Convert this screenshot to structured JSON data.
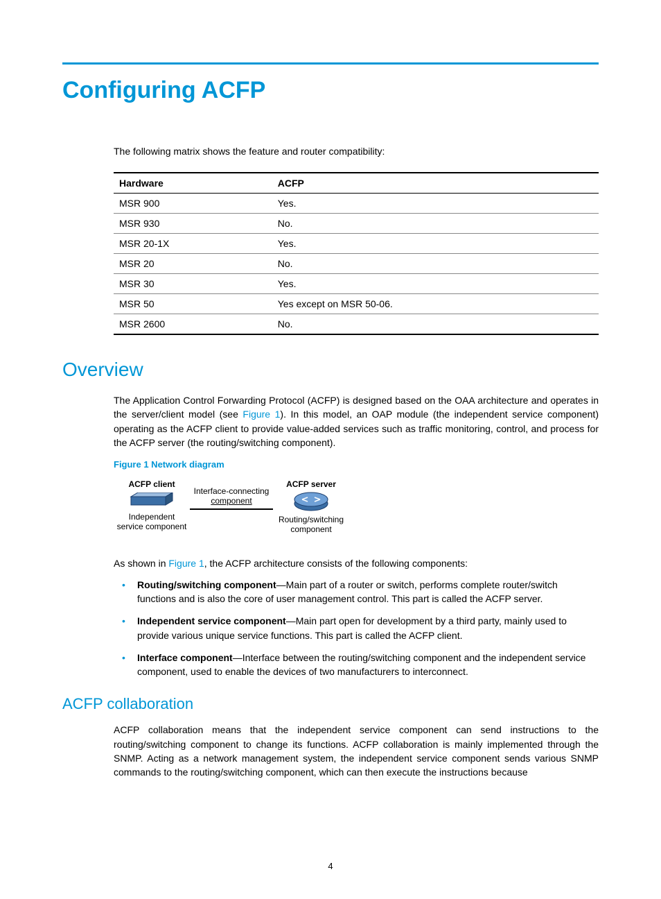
{
  "title": "Configuring ACFP",
  "intro": "The following matrix shows the feature and router compatibility:",
  "table": {
    "headers": [
      "Hardware",
      "ACFP"
    ],
    "rows": [
      [
        "MSR 900",
        "Yes."
      ],
      [
        "MSR 930",
        "No."
      ],
      [
        "MSR 20-1X",
        "Yes."
      ],
      [
        "MSR 20",
        "No."
      ],
      [
        "MSR 30",
        "Yes."
      ],
      [
        "MSR 50",
        "Yes except on MSR 50-06."
      ],
      [
        "MSR 2600",
        "No."
      ]
    ]
  },
  "overview": {
    "heading": "Overview",
    "para1_a": "The Application Control Forwarding Protocol (ACFP) is designed based on the OAA architecture and operates in the server/client model (see ",
    "para1_link": "Figure 1",
    "para1_b": "). In this model, an OAP module (the independent service component) operating as the ACFP client to provide value-added services such as traffic monitoring, control, and process for the ACFP server (the routing/switching component)."
  },
  "figure": {
    "title": "Figure 1 Network diagram",
    "client_label": "ACFP client",
    "client_sub": "Independent\nservice component",
    "server_label": "ACFP server",
    "server_sub": "Routing/switching\ncomponent",
    "mid_top": "Interface-connecting",
    "mid_bottom": "component"
  },
  "after_fig": {
    "line_a": "As shown in ",
    "link": "Figure 1",
    "line_b": ", the ACFP architecture consists of the following components:"
  },
  "bullets": [
    {
      "bold": "Routing/switching component",
      "rest": "—Main part of a router or switch, performs complete router/switch functions and is also the core of user management control. This part is called the ACFP server."
    },
    {
      "bold": "Independent service component",
      "rest": "—Main part open for development by a third party, mainly used to provide various unique service functions. This part is called the ACFP client."
    },
    {
      "bold": "Interface component",
      "rest": "—Interface between the routing/switching component and the independent service component, used to enable the devices of two manufacturers to interconnect."
    }
  ],
  "collab": {
    "heading": "ACFP collaboration",
    "para": "ACFP collaboration means that the independent service component can send instructions to the routing/switching component to change its functions. ACFP collaboration is mainly implemented through the SNMP. Acting as a network management system, the independent service component sends various SNMP commands to the routing/switching component, which can then execute the instructions because"
  },
  "page_number": "4"
}
